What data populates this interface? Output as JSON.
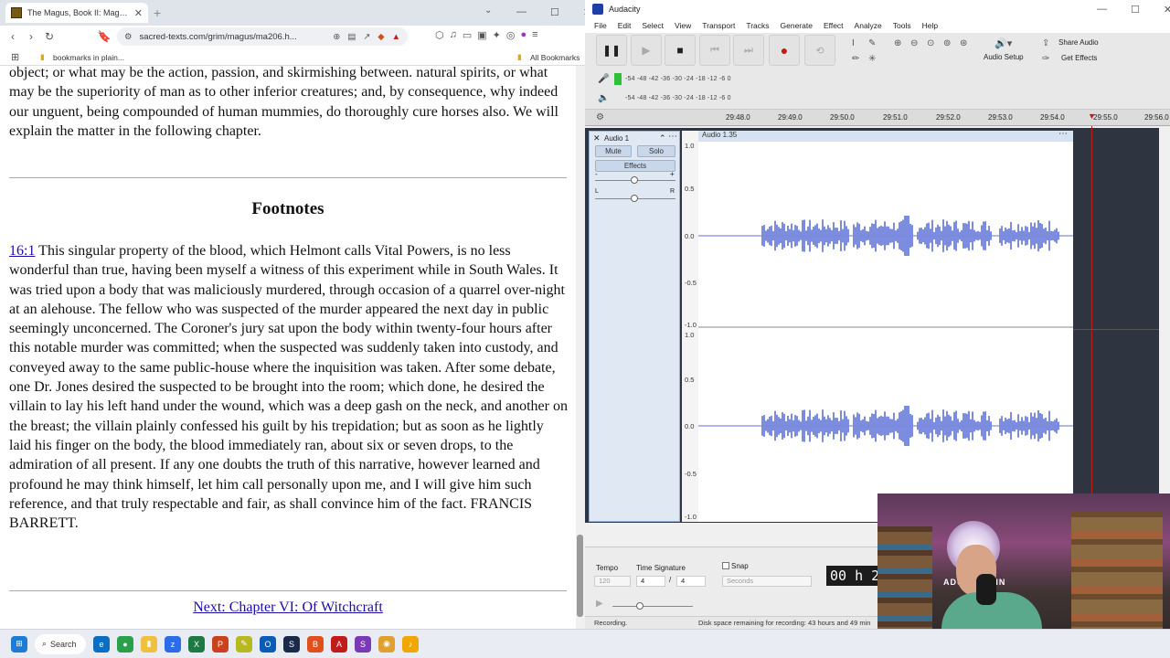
{
  "browser": {
    "tab_title": "The Magus, Book II: Magnetism",
    "url": "sacred-texts.com/grim/magus/ma206.h...",
    "bookmarks_folder": "bookmarks in plain...",
    "all_bookmarks": "All Bookmarks",
    "page": {
      "intro": "object; or what may be the action, passion, and skirmishing between. natural spirits, or what may be the superiority of man as to other inferior creatures; and, by consequence, why indeed our unguent, being compounded of human mummies, do thoroughly cure horses also. We will explain the matter in the following chapter.",
      "footnotes_heading": "Footnotes",
      "footnote_ref": "16:1",
      "footnote_text": " This singular property of the blood, which Helmont calls Vital Powers, is no less wonderful than true, having been myself a witness of this experiment while in South Wales. It was tried upon a body that was maliciously murdered, through occasion of a quarrel over-night at an alehouse. The fellow who was suspected of the murder appeared the next day in public seemingly unconcerned. The Coroner's jury sat upon the body within twenty-four hours after this notable murder was committed; when the suspected was suddenly taken into custody, and conveyed away to the same public-house where the inquisition was taken. After some debate, one Dr. Jones desired the suspected to be brought into the room; which done, he desired the villain to lay his left hand under the wound, which was a deep gash on the neck, and another on the breast; the villain plainly confessed his guilt by his trepidation; but as soon as he lightly laid his finger on the body, the blood immediately ran, about six or seven drops, to the admiration of all present. If any one doubts the truth of this narrative, however learned and profound he may think himself, let him call personally upon me, and I will give him such reference, and that truly respectable and fair, as shall convince him of the fact. FRANCIS BARRETT.",
      "next_link": "Next: Chapter VI: Of Witchcraft"
    }
  },
  "audacity": {
    "title": "Audacity",
    "menu": [
      "File",
      "Edit",
      "Select",
      "View",
      "Transport",
      "Tracks",
      "Generate",
      "Effect",
      "Analyze",
      "Tools",
      "Help"
    ],
    "audio_setup": "Audio Setup",
    "share_audio": "Share Audio",
    "get_effects": "Get Effects",
    "meter_scale": "-54 -48 -42 -36 -30 -24 -18 -12 -6 0",
    "timeline_labels": [
      "29:48.0",
      "29:49.0",
      "29:50.0",
      "29:51.0",
      "29:52.0",
      "29:53.0",
      "29:54.0",
      "29:55.0",
      "29:56.0"
    ],
    "track": {
      "name": "Audio 1",
      "mute": "Mute",
      "solo": "Solo",
      "effects": "Effects",
      "gain_minus": "-",
      "gain_plus": "+",
      "pan_left": "L",
      "pan_right": "R",
      "clip_name": "Audio 1.35"
    },
    "ruler_labels": [
      "1.0",
      "0.5",
      "0.0",
      "-0.5",
      "-1.0"
    ],
    "bottom": {
      "tempo_label": "Tempo",
      "tempo_value": "120",
      "time_sig_label": "Time Signature",
      "time_sig_num": "4",
      "time_sig_slash": "/",
      "time_sig_den": "4",
      "snap_label": "Snap",
      "snap_unit": "Seconds",
      "time_display": "00 h 2"
    },
    "status_left": "Recording.",
    "status_right": "Disk space remaining for recording: 43 hours and 49 min"
  },
  "webcam": {
    "banner": "ADULTBRAIN"
  },
  "taskbar": {
    "search": "Search"
  }
}
